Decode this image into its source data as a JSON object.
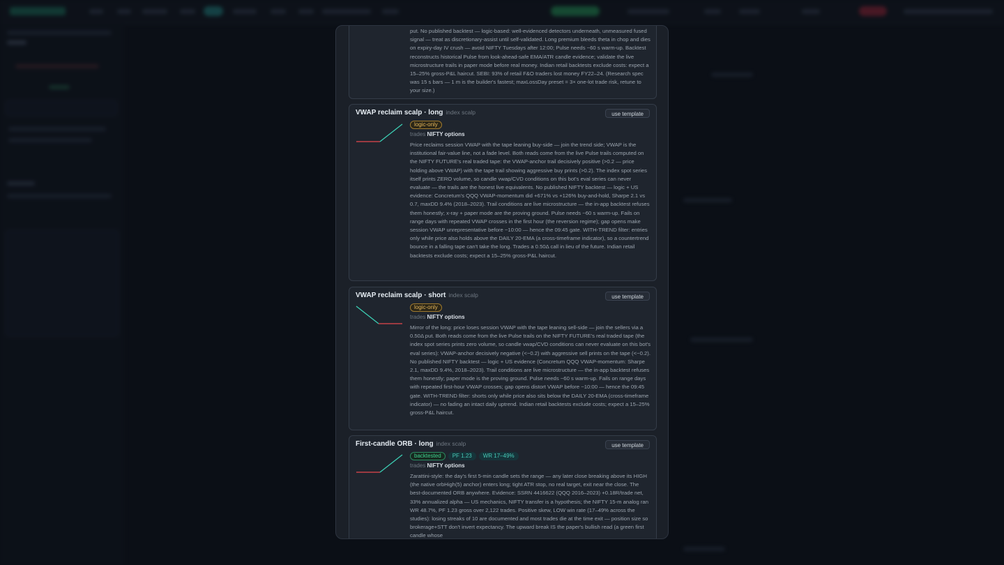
{
  "modal": {
    "use_template_label": "use template",
    "trades_prefix": "trades",
    "partial_top_description": "put. No published backtest — logic-based: well-evidenced detectors underneath, unmeasured fused signal — treat as discretionary-assist until self-validated. Long premium bleeds theta in chop and dies on expiry-day IV crush — avoid NIFTY Tuesdays after 12:00; Pulse needs ~60 s warm-up. Backtest reconstructs historical Pulse from look-ahead-safe EMA/ATR candle evidence; validate the live microstructure trails in paper mode before real money. Indian retail backtests exclude costs: expect a 15–25% gross-P&L haircut. SEBI: 93% of retail F&O traders lost money FY22–24. (Research spec was 15 s bars — 1 m is the builder's fastest; maxLossDay preset = 3× one-lot trade risk, retune to your size.)",
    "cards": [
      {
        "title": "VWAP reclaim scalp · long",
        "category": "index scalp",
        "badge": "logic-only",
        "instrument": "NIFTY options",
        "description": "Price reclaims session VWAP with the tape leaning buy-side — join the trend side; VWAP is the institutional fair-value line, not a fade level. Both reads come from the live Pulse trails computed on the NIFTY FUTURE's real traded tape: the VWAP-anchor trail decisively positive (>0.2 — price holding above VWAP) with the tape trail showing aggressive buy prints (>0.2). The index spot series itself prints ZERO volume, so candle vwap/CVD conditions on this bot's eval series can never evaluate — the trails are the honest live equivalents. No published NIFTY backtest — logic + US evidence: Concretum's QQQ VWAP-momentum did +671% vs +126% buy-and-hold, Sharpe 2.1 vs 0.7, maxDD 9.4% (2018–2023). Trail conditions are live microstructure — the in-app backtest refuses them honestly; x-ray + paper mode are the proving ground. Pulse needs ~60 s warm-up. Fails on range days with repeated VWAP crosses in the first hour (the reversion regime); gap opens make session VWAP unrepresentative before ~10:00 — hence the 09:45 gate. WITH-TREND filter: entries only while price also holds above the DAILY 20-EMA (a cross-timeframe indicator), so a countertrend bounce in a falling tape can't take the long. Trades a 0.50Δ call in lieu of the future. Indian retail backtests exclude costs; expect a 15–25% gross-P&L haircut."
      },
      {
        "title": "VWAP reclaim scalp · short",
        "category": "index scalp",
        "badge": "logic-only",
        "instrument": "NIFTY options",
        "description": "Mirror of the long: price loses session VWAP with the tape leaning sell-side — join the sellers via a 0.50Δ put. Both reads come from the live Pulse trails on the NIFTY FUTURE's real traded tape (the index spot series prints zero volume, so candle vwap/CVD conditions can never evaluate on this bot's eval series): VWAP-anchor decisively negative (<−0.2) with aggressive sell prints on the tape (<−0.2). No published NIFTY backtest — logic + US evidence (Concretum QQQ VWAP-momentum: Sharpe 2.1, maxDD 9.4%, 2018–2023). Trail conditions are live microstructure — the in-app backtest refuses them honestly; paper mode is the proving ground. Pulse needs ~60 s warm-up. Fails on range days with repeated first-hour VWAP crosses; gap opens distort VWAP before ~10:00 — hence the 09:45 gate. WITH-TREND filter: shorts only while price also sits below the DAILY 20-EMA (cross-timeframe indicator) — no fading an intact daily uptrend. Indian retail backtests exclude costs; expect a 15–25% gross-P&L haircut."
      },
      {
        "title": "First-candle ORB · long",
        "category": "index scalp",
        "badge": "backtested",
        "stat_pf": "PF 1.23",
        "stat_wr": "WR 17–49%",
        "instrument": "NIFTY options",
        "description": "Zarattini-style: the day's first 5-min candle sets the range — any later close breaking above its HIGH (the native orbHigh(5) anchor) enters long; tight ATR stop, no real target, exit near the close. The best-documented ORB anywhere. Evidence: SSRN 4416622 (QQQ 2016–2023) +0.18R/trade net, 33% annualized alpha — US mechanics, NIFTY transfer is a hypothesis; the NIFTY 15-m analog ran WR 48.7%, PF 1.23 gross over 2,122 trades. Positive skew, LOW win rate (17–49% across the studies): losing streaks of 10 are documented and most trades die at the time exit — position size so brokerage+STT don't invert expectancy. The upward break IS the paper's bullish read (a green first candle whose"
      }
    ]
  },
  "colors": {
    "spark_red": "#e5484d",
    "spark_teal": "#3ccfb4",
    "badge_logic": "#e2b45a",
    "badge_backtested": "#3ecf8e"
  }
}
